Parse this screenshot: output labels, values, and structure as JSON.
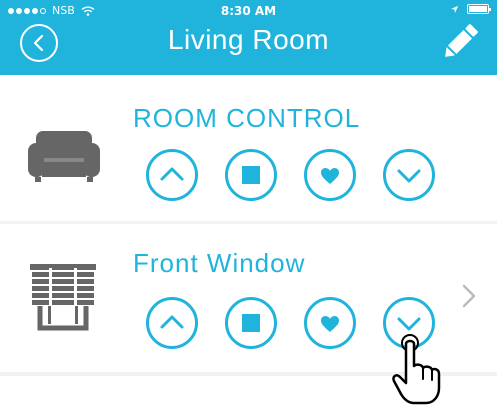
{
  "status_bar": {
    "carrier": "NSB",
    "time": "8:30 AM"
  },
  "header": {
    "title": "Living Room"
  },
  "rooms": [
    {
      "label": "ROOM CONTROL",
      "icon": "sofa-icon"
    },
    {
      "label": "Front Window",
      "icon": "blinds-icon"
    }
  ],
  "colors": {
    "accent": "#20b4dc",
    "icon_gray": "#666666"
  }
}
